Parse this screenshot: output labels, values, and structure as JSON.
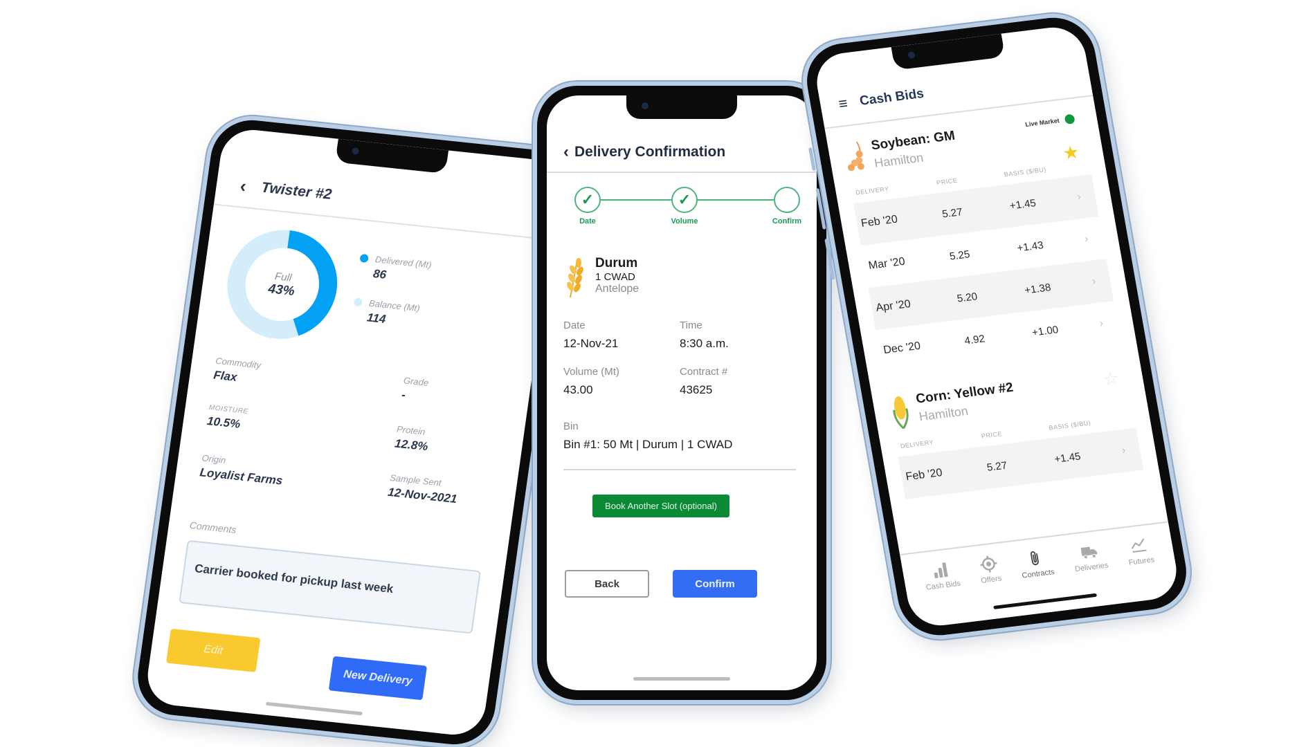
{
  "left_phone": {
    "header": {
      "title": "Twister #2",
      "back_icon": "chevron-left-icon"
    },
    "chart_data": {
      "type": "pie",
      "title": "",
      "center_label": "Full",
      "center_value": "43%",
      "slices": [
        {
          "name": "Delivered (Mt)",
          "value": 86,
          "color": "#03a1f3"
        },
        {
          "name": "Balance (Mt)",
          "value": 114,
          "color": "#d3edfb"
        }
      ]
    },
    "legend": [
      {
        "label": "Delivered (Mt)",
        "value": "86",
        "color": "#03a1f3"
      },
      {
        "label": "Balance (Mt)",
        "value": "114",
        "color": "#d3edfb"
      }
    ],
    "fields": [
      {
        "label": "Commodity",
        "value": "Flax"
      },
      {
        "label": "Grade",
        "value": "-"
      },
      {
        "label": "Moisture",
        "value": "10.5%"
      },
      {
        "label": "Protein",
        "value": "12.8%"
      },
      {
        "label": "Origin",
        "value": "Loyalist Farms"
      },
      {
        "label": "Sample Sent",
        "value": "12-Nov-2021"
      }
    ],
    "comments": {
      "label": "Comments",
      "value": "Carrier booked for pickup last week"
    },
    "buttons": {
      "edit": "Edit",
      "new_delivery": "New Delivery"
    },
    "colors": {
      "edit": "#f9c92d",
      "new_delivery": "#2f6bf6"
    }
  },
  "middle_phone": {
    "header": {
      "title": "Delivery Confirmation",
      "back_icon": "chevron-left-icon"
    },
    "stepper": [
      {
        "label": "Date",
        "complete": true
      },
      {
        "label": "Volume",
        "complete": true
      },
      {
        "label": "Confirm",
        "complete": false
      }
    ],
    "crop": {
      "name": "Durum",
      "grade": "1 CWAD",
      "location": "Antelope",
      "icon": "wheat-icon"
    },
    "fields": [
      {
        "label": "Date",
        "value": "12-Nov-21"
      },
      {
        "label": "Time",
        "value": "8:30 a.m."
      },
      {
        "label": "Volume (Mt)",
        "value": "43.00"
      },
      {
        "label": "Contract #",
        "value": "43625"
      }
    ],
    "bin": {
      "label": "Bin",
      "value": "Bin #1: 50 Mt | Durum | 1 CWAD"
    },
    "buttons": {
      "book_another": "Book Another Slot (optional)",
      "back": "Back",
      "confirm": "Confirm"
    },
    "colors": {
      "accent_green": "#0a8a34",
      "confirm_blue": "#336df2",
      "stepper_green": "#4cb47e"
    }
  },
  "right_phone": {
    "header": {
      "title": "Cash Bids",
      "menu_icon": "hamburger-menu-icon"
    },
    "columns": [
      "DELIVERY",
      "PRICE",
      "BASIS ($/BU)"
    ],
    "commodities": [
      {
        "name": "Soybean: GM",
        "location": "Hamilton",
        "icon": "soybean-icon",
        "live_market_label": "Live Market",
        "favorite": true,
        "rows": [
          {
            "delivery": "Feb '20",
            "price": "5.27",
            "basis": "+1.45"
          },
          {
            "delivery": "Mar '20",
            "price": "5.25",
            "basis": "+1.43"
          },
          {
            "delivery": "Apr '20",
            "price": "5.20",
            "basis": "+1.38"
          },
          {
            "delivery": "Dec '20",
            "price": "4.92",
            "basis": "+1.00"
          }
        ]
      },
      {
        "name": "Corn: Yellow #2",
        "location": "Hamilton",
        "icon": "corn-icon",
        "favorite": false,
        "rows": [
          {
            "delivery": "Feb '20",
            "price": "5.27",
            "basis": "+1.45"
          }
        ]
      }
    ],
    "tabs": [
      {
        "label": "Cash Bids",
        "icon": "bar-chart-icon",
        "active": false
      },
      {
        "label": "Offers",
        "icon": "target-icon",
        "active": false
      },
      {
        "label": "Contracts",
        "icon": "paperclip-icon",
        "active": true
      },
      {
        "label": "Deliveries",
        "icon": "truck-icon",
        "active": false
      },
      {
        "label": "Futures",
        "icon": "trend-line-icon",
        "active": false
      }
    ],
    "colors": {
      "live_dot": "#0e9a3b",
      "star_active": "#f7c81e"
    }
  }
}
